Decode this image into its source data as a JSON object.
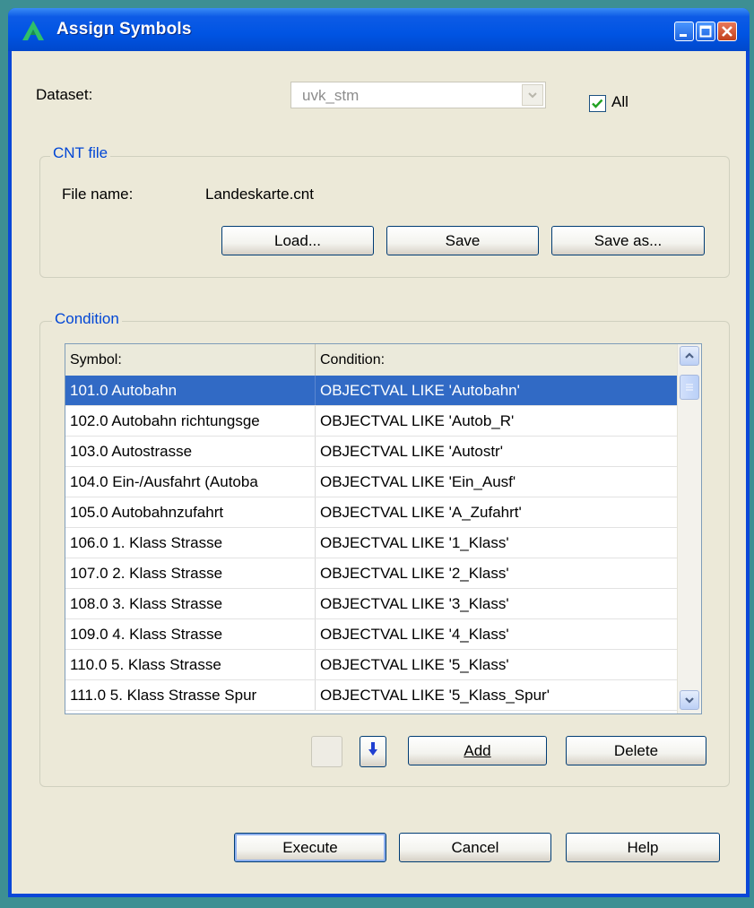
{
  "window": {
    "title": "Assign Symbols"
  },
  "dataset": {
    "label": "Dataset:",
    "value": "uvk_stm",
    "all_label": "All",
    "all_checked": true
  },
  "cnt_group": {
    "label": "CNT file",
    "file_label": "File name:",
    "file_value": "Landeskarte.cnt",
    "load": "Load...",
    "save": "Save",
    "save_as": "Save as..."
  },
  "condition_group": {
    "label": "Condition",
    "columns": [
      "Symbol:",
      "Condition:"
    ],
    "rows": [
      {
        "symbol": "101.0 Autobahn",
        "condition": "OBJECTVAL LIKE 'Autobahn'",
        "selected": true
      },
      {
        "symbol": "102.0 Autobahn richtungsge",
        "condition": "OBJECTVAL LIKE 'Autob_R'"
      },
      {
        "symbol": "103.0 Autostrasse",
        "condition": "OBJECTVAL LIKE 'Autostr'"
      },
      {
        "symbol": "104.0 Ein-/Ausfahrt (Autoba",
        "condition": "OBJECTVAL LIKE 'Ein_Ausf'"
      },
      {
        "symbol": "105.0 Autobahnzufahrt",
        "condition": "OBJECTVAL LIKE 'A_Zufahrt'"
      },
      {
        "symbol": "106.0 1. Klass Strasse",
        "condition": "OBJECTVAL LIKE '1_Klass'"
      },
      {
        "symbol": "107.0 2. Klass Strasse",
        "condition": "OBJECTVAL LIKE '2_Klass'"
      },
      {
        "symbol": "108.0 3. Klass Strasse",
        "condition": "OBJECTVAL LIKE '3_Klass'"
      },
      {
        "symbol": "109.0 4. Klass Strasse",
        "condition": "OBJECTVAL LIKE '4_Klass'"
      },
      {
        "symbol": "110.0 5. Klass Strasse",
        "condition": "OBJECTVAL LIKE '5_Klass'"
      },
      {
        "symbol": "111.0 5. Klass Strasse Spur",
        "condition": "OBJECTVAL LIKE '5_Klass_Spur'"
      }
    ],
    "add": "Add",
    "delete": "Delete"
  },
  "footer": {
    "execute": "Execute",
    "cancel": "Cancel",
    "help": "Help"
  },
  "icons": [
    "app-logo-icon",
    "minimize-icon",
    "maximize-icon",
    "close-icon",
    "chevron-down-icon",
    "check-icon",
    "scroll-up-icon",
    "scroll-down-icon",
    "move-up-icon",
    "move-down-icon"
  ],
  "colors": {
    "titlebar": "#0054e3",
    "face": "#ece9d8",
    "selection": "#316ac5",
    "group_label": "#0046d5"
  }
}
